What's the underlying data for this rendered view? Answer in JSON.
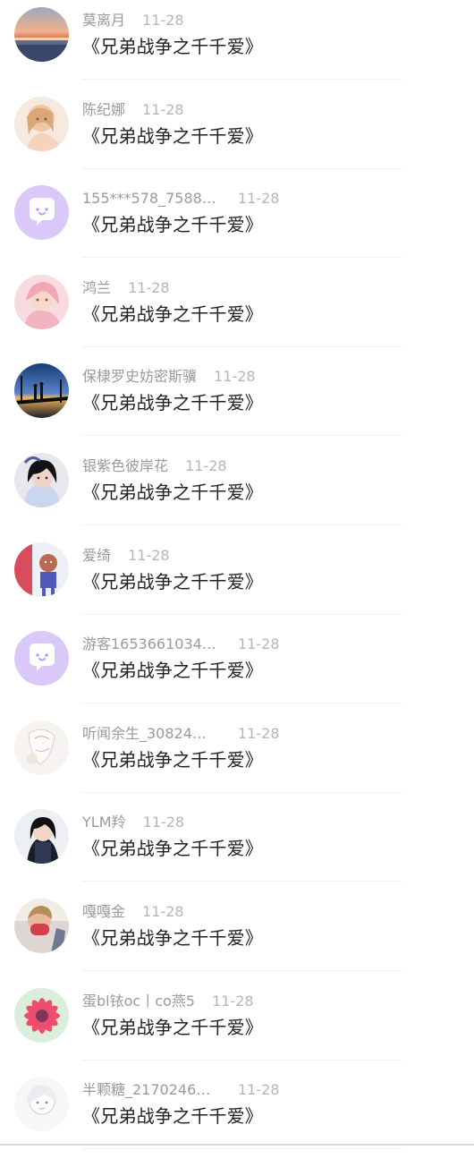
{
  "comments": [
    {
      "name": "莫离月",
      "date": "11-28",
      "title": "《兄弟战争之千千爱》",
      "avatar_icon": "sunset-avatar-icon",
      "date_far": false
    },
    {
      "name": "陈纪娜",
      "date": "11-28",
      "title": "《兄弟战争之千千爱》",
      "avatar_icon": "anime-girl-avatar-icon",
      "date_far": false
    },
    {
      "name": "155***578_7588…",
      "date": "11-28",
      "title": "《兄弟战争之千千爱》",
      "avatar_icon": "default-chat-avatar-icon",
      "date_far": true
    },
    {
      "name": "鸿兰",
      "date": "11-28",
      "title": "《兄弟战争之千千爱》",
      "avatar_icon": "pink-hair-avatar-icon",
      "date_far": false
    },
    {
      "name": "保棣罗史妨密斯骥",
      "date": "11-28",
      "title": "《兄弟战争之千千爱》",
      "avatar_icon": "night-couple-avatar-icon",
      "date_far": false
    },
    {
      "name": "银紫色彼岸花",
      "date": "11-28",
      "title": "《兄弟战争之千千爱》",
      "avatar_icon": "portrait-girl-avatar-icon",
      "date_far": false
    },
    {
      "name": "爱绮",
      "date": "11-28",
      "title": "《兄弟战争之千千爱》",
      "avatar_icon": "figure-avatar-icon",
      "date_far": false
    },
    {
      "name": "游客1653661034…",
      "date": "11-28",
      "title": "《兄弟战争之千千爱》",
      "avatar_icon": "default-chat-avatar-icon",
      "date_far": true
    },
    {
      "name": "听闻余生_30824…",
      "date": "11-28",
      "title": "《兄弟战争之千千爱》",
      "avatar_icon": "sketch-avatar-icon",
      "date_far": true
    },
    {
      "name": "YLM羚",
      "date": "11-28",
      "title": "《兄弟战争之千千爱》",
      "avatar_icon": "dark-hair-avatar-icon",
      "date_far": false
    },
    {
      "name": "嘎嘎金",
      "date": "11-28",
      "title": "《兄弟战争之千千爱》",
      "avatar_icon": "mask-avatar-icon",
      "date_far": false
    },
    {
      "name": "蛋bl铱oc丨co燕5",
      "date": "11-28",
      "title": "《兄弟战争之千千爱》",
      "avatar_icon": "flower-avatar-icon",
      "date_far": false
    },
    {
      "name": "半颗糖_2170246…",
      "date": "11-28",
      "title": "《兄弟战争之千千爱》",
      "avatar_icon": "white-hair-avatar-icon",
      "date_far": true
    }
  ],
  "colors": {
    "name": "#9a9a9a",
    "date": "#b6b6b6",
    "title": "#222222",
    "divider": "#f2f2f2",
    "default_avatar": "#d9c6f6"
  }
}
